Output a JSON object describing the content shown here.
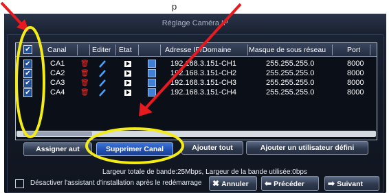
{
  "top_text": "p",
  "window": {
    "title": "Réglage Caméra IP"
  },
  "table": {
    "columns": [
      "Canal",
      "Editer",
      "Etat",
      "Adresse IP/Domaine",
      "Masque de sous réseau",
      "Port"
    ],
    "rows": [
      {
        "canal": "CA1",
        "address": "192.168.3.151-CH1",
        "mask": "255.255.255.0",
        "port": "8000"
      },
      {
        "canal": "CA2",
        "address": "192.168.3.151-CH2",
        "mask": "255.255.255.0",
        "port": "8000"
      },
      {
        "canal": "CA3",
        "address": "192.168.3.151-CH3",
        "mask": "255.255.255.0",
        "port": "8000"
      },
      {
        "canal": "CA4",
        "address": "192.168.3.151-CH4",
        "mask": "255.255.255.0",
        "port": "8000"
      }
    ]
  },
  "buttons": {
    "assign": "Assigner aut",
    "delete": "Supprimer Canal",
    "add_all": "Ajouter tout",
    "add_user": "Ajouter un utilisateur défini"
  },
  "status": "Largeur totale de bande:25Mbps,  Largeur de la bande utilisée:0bps",
  "bottom": {
    "disable_label": "Désactiver l'assistant d'installation après le redémarrage",
    "cancel": "Annuler",
    "previous": "Précéder",
    "next": "Suivant"
  },
  "icons": {
    "checkbox_checked": "check-icon",
    "delete_row": "trash-icon",
    "edit_row": "pencil-icon",
    "state": "play-icon",
    "edit_address": "edit-icon",
    "cancel": "close-icon",
    "previous": "arrow-left-icon",
    "next": "arrow-right-icon"
  },
  "colors": {
    "annotation_red": "#e8191f",
    "annotation_yellow": "#f4ec17",
    "active_button": "#2a5fc8",
    "trash": "#e23434"
  }
}
